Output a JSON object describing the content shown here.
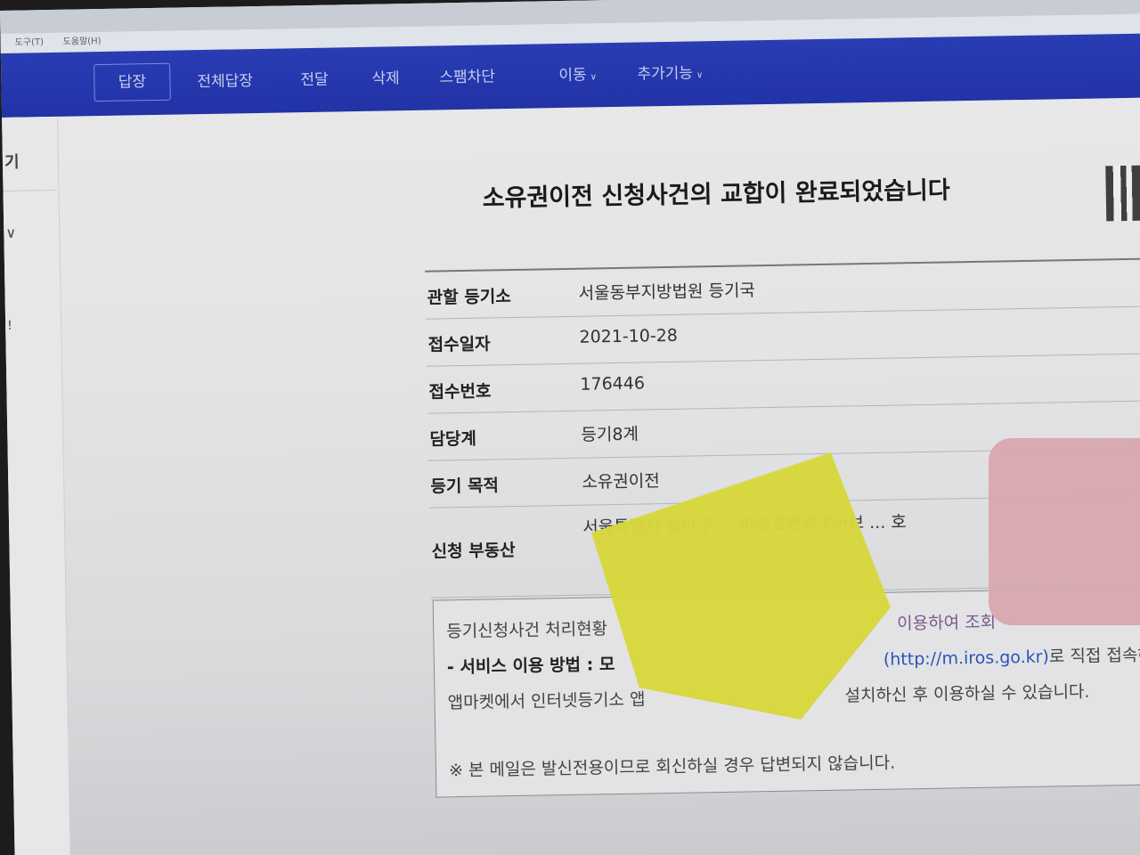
{
  "menubar": {
    "items": [
      "도구(T)",
      "도움말(H)"
    ]
  },
  "toolbar": {
    "reply": "답장",
    "reply_all": "전체답장",
    "forward": "전달",
    "delete": "삭제",
    "spam_block": "스팸차단",
    "move": "이동",
    "more": "추가기능"
  },
  "sidebar": {
    "partial_title": "기",
    "partial_mark": "!"
  },
  "email": {
    "title": "소유권이전 신청사건의 교합이 완료되었습니다",
    "rows": [
      {
        "label": "관할 등기소",
        "value": "서울동부지방법원 등기국"
      },
      {
        "label": "접수일자",
        "value": "2021-10-28"
      },
      {
        "label": "접수번호",
        "value": "176446"
      },
      {
        "label": "담당계",
        "value": "등기8계"
      },
      {
        "label": "등기 목적",
        "value": "소유권이전"
      },
      {
        "label": "신청 부동산",
        "value": "서울특별시 송파구 ... 아양호반써밋아브 ... 호"
      }
    ],
    "notice": {
      "line1_start": "등기신청사건 처리현황",
      "line1_end": "이용하여 조회",
      "line2_bold": "- 서비스 이용 방법 : 모",
      "line2_link": "(http://m.iros.go.kr)",
      "line2_end": "로 직접 접속하",
      "line3_start": "앱마켓에서 인터넷등기소 앱",
      "line3_end": "설치하신 후 이용하실 수 있습니다.",
      "footer": "※ 본 메일은 발신전용이므로 회신하실 경우 답변되지 않습니다."
    }
  }
}
